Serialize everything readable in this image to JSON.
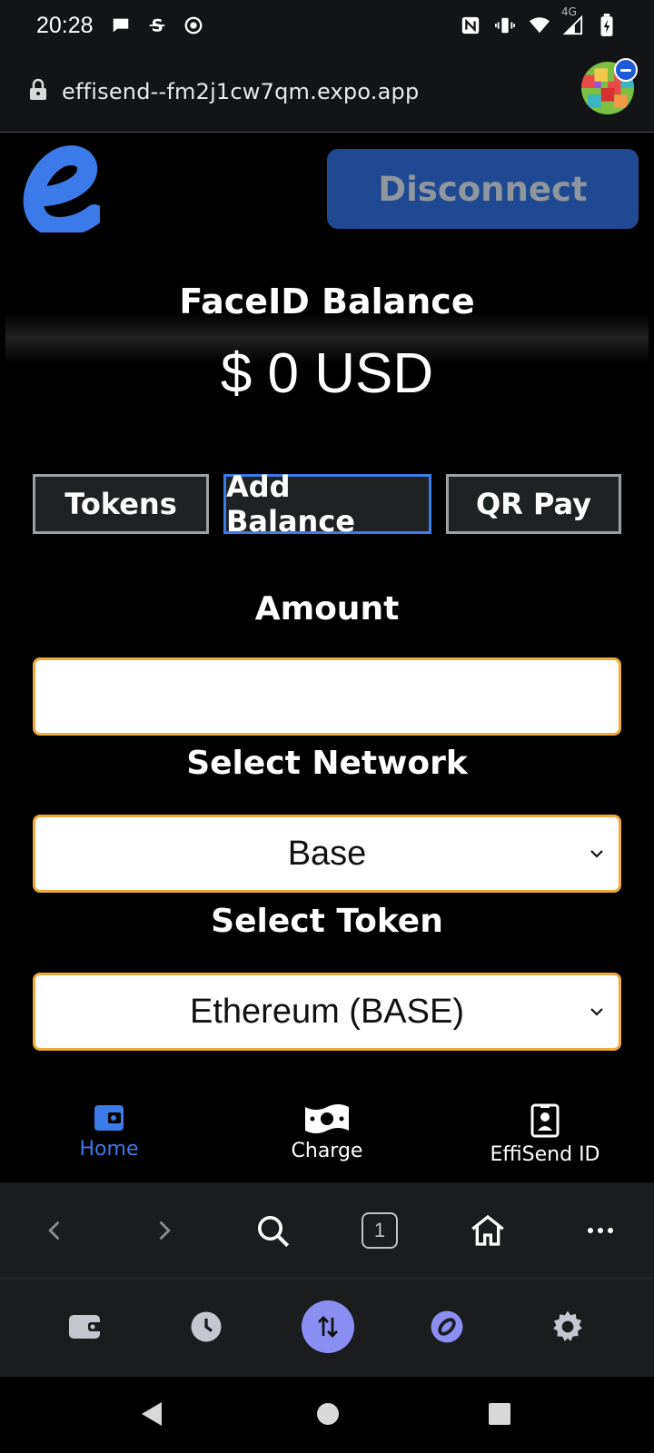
{
  "status_bar": {
    "time": "20:28",
    "network_label": "4G"
  },
  "browser": {
    "url": "effisend--fm2j1cw7qm.expo.app",
    "tab_count": "1"
  },
  "app": {
    "disconnect_label": "Disconnect",
    "balance_title": "FaceID Balance",
    "balance_value": "$ 0 USD",
    "tabs": [
      {
        "label": "Tokens"
      },
      {
        "label": "Add Balance",
        "active": true
      },
      {
        "label": "QR Pay"
      }
    ],
    "amount_label": "Amount",
    "amount_value": "",
    "network_label": "Select Network",
    "network_value": "Base",
    "token_label": "Select Token",
    "token_value": "Ethereum (BASE)",
    "nav": [
      {
        "label": "Home",
        "icon": "wallet-icon",
        "active": true
      },
      {
        "label": "Charge",
        "icon": "cash-icon"
      },
      {
        "label": "EffiSend ID",
        "icon": "id-card-icon"
      }
    ]
  },
  "colors": {
    "accent_blue": "#3b7ae8",
    "field_border": "#f0a93a",
    "disconnect_bg": "#1f4a91"
  }
}
